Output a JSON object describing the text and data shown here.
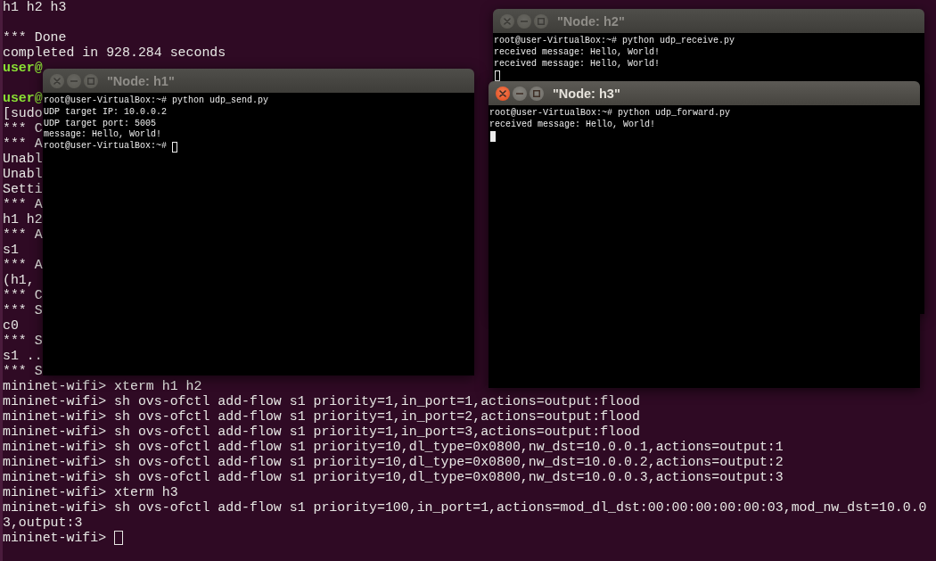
{
  "terminal": {
    "focused": false,
    "lines": [
      {
        "kind": "output",
        "text": "h1 h2 h3"
      },
      {
        "kind": "blank"
      },
      {
        "kind": "output",
        "text": "*** Done"
      },
      {
        "kind": "output",
        "text": "completed in 928.284 seconds"
      },
      {
        "kind": "user_prompt",
        "text": "user@"
      },
      {
        "kind": "blank"
      },
      {
        "kind": "user_prompt",
        "text": "user@"
      },
      {
        "kind": "output",
        "text": "[sudo"
      },
      {
        "kind": "output",
        "text": "*** C"
      },
      {
        "kind": "output",
        "text": "*** A"
      },
      {
        "kind": "output",
        "text": "Unabl"
      },
      {
        "kind": "output",
        "text": "Unabl"
      },
      {
        "kind": "output",
        "text": "Setti"
      },
      {
        "kind": "output",
        "text": "*** A"
      },
      {
        "kind": "output",
        "text": "h1 h2"
      },
      {
        "kind": "output",
        "text": "*** A"
      },
      {
        "kind": "output",
        "text": "s1"
      },
      {
        "kind": "output",
        "text": "*** A"
      },
      {
        "kind": "output",
        "text": "(h1,"
      },
      {
        "kind": "output",
        "text": "*** C"
      },
      {
        "kind": "output",
        "text": "*** S"
      },
      {
        "kind": "output",
        "text": "c0"
      },
      {
        "kind": "output",
        "text": "*** S"
      },
      {
        "kind": "output",
        "text": "s1 .."
      },
      {
        "kind": "output",
        "text": "*** S"
      },
      {
        "kind": "output",
        "text": "mininet-wifi> xterm h1 h2"
      },
      {
        "kind": "output",
        "text": "mininet-wifi> sh ovs-ofctl add-flow s1 priority=1,in_port=1,actions=output:flood"
      },
      {
        "kind": "output",
        "text": "mininet-wifi> sh ovs-ofctl add-flow s1 priority=1,in_port=2,actions=output:flood"
      },
      {
        "kind": "output",
        "text": "mininet-wifi> sh ovs-ofctl add-flow s1 priority=1,in_port=3,actions=output:flood"
      },
      {
        "kind": "output",
        "text": "mininet-wifi> sh ovs-ofctl add-flow s1 priority=10,dl_type=0x0800,nw_dst=10.0.0.1,actions=output:1"
      },
      {
        "kind": "output",
        "text": "mininet-wifi> sh ovs-ofctl add-flow s1 priority=10,dl_type=0x0800,nw_dst=10.0.0.2,actions=output:2"
      },
      {
        "kind": "output",
        "text": "mininet-wifi> sh ovs-ofctl add-flow s1 priority=10,dl_type=0x0800,nw_dst=10.0.0.3,actions=output:3"
      },
      {
        "kind": "output",
        "text": "mininet-wifi> xterm h3"
      },
      {
        "kind": "output",
        "text": "mininet-wifi> sh ovs-ofctl add-flow s1 priority=100,in_port=1,actions=mod_dl_dst:00:00:00:00:00:03,mod_nw_dst=10.0.0"
      },
      {
        "kind": "output",
        "text": "3,output:3"
      }
    ],
    "cursor_text": "mininet-wifi>"
  },
  "windows": [
    {
      "title": "\"Node: h1\"",
      "focused": false,
      "lines": [
        "root@user-VirtualBox:~# python udp_send.py",
        "UDP target IP: 10.0.0.2",
        "UDP target port: 5005",
        "message: Hello, World!"
      ],
      "cursor_text": "root@user-VirtualBox:~#"
    },
    {
      "title": "\"Node: h2\"",
      "focused": false,
      "lines": [
        "root@user-VirtualBox:~# python udp_receive.py",
        "received message: Hello, World!",
        "received message: Hello, World!"
      ]
    },
    {
      "title": "\"Node: h3\"",
      "focused": true,
      "lines": [
        "root@user-VirtualBox:~# python udp_forward.py",
        "received message: Hello, World!"
      ]
    }
  ]
}
